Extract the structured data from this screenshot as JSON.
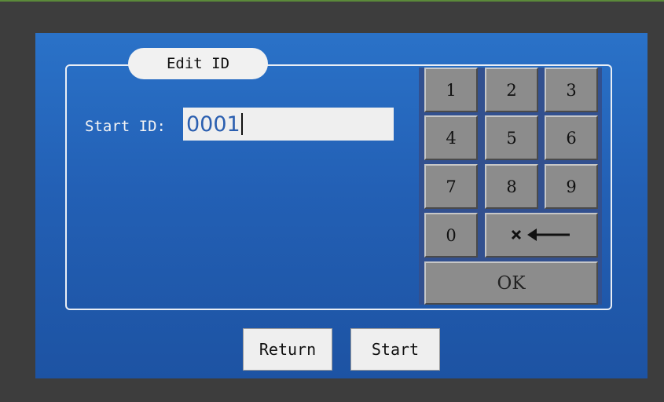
{
  "panel": {
    "title": "Edit ID"
  },
  "form": {
    "start_id_label": "Start ID:",
    "start_id_value": "0001"
  },
  "keypad": {
    "keys": [
      "1",
      "2",
      "3",
      "4",
      "5",
      "6",
      "7",
      "8",
      "9",
      "0"
    ],
    "backspace_icon": "backspace-arrow-icon",
    "ok_label": "OK"
  },
  "actions": {
    "return_label": "Return",
    "start_label": "Start"
  },
  "colors": {
    "screen_top": "#2a72c8",
    "screen_bottom": "#1d53a3",
    "keypad_bg": "#32508f",
    "key_face": "#8c8c8c"
  }
}
